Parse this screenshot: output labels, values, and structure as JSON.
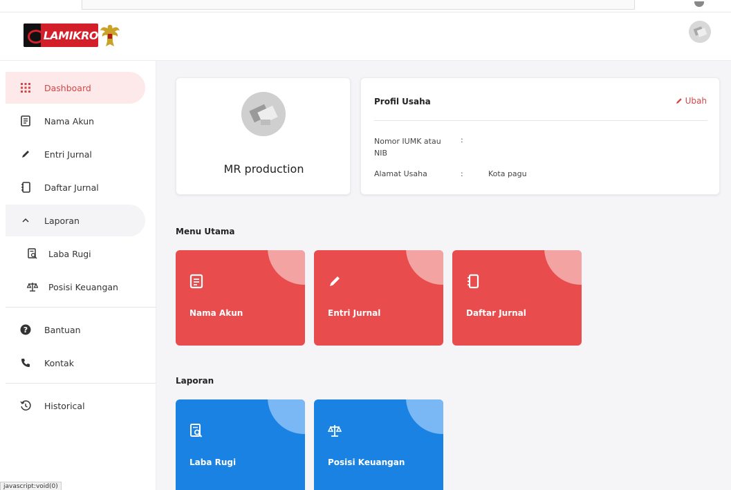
{
  "brand": {
    "logo_text": "LAMIKRO"
  },
  "sidebar": {
    "items": [
      {
        "label": "Dashboard"
      },
      {
        "label": "Nama Akun"
      },
      {
        "label": "Entri Jurnal"
      },
      {
        "label": "Daftar Jurnal"
      },
      {
        "label": "Laporan"
      },
      {
        "label": "Laba Rugi"
      },
      {
        "label": "Posisi Keuangan"
      },
      {
        "label": "Bantuan"
      },
      {
        "label": "Kontak"
      },
      {
        "label": "Historical"
      }
    ]
  },
  "status_bar": {
    "text": "javascript:void(0)"
  },
  "profile": {
    "name": "MR production"
  },
  "business_profile": {
    "title": "Profil Usaha",
    "edit_label": "Ubah",
    "iumk_label_line1": "Nomor IUMK atau",
    "iumk_label_line2": "NIB",
    "iumk_colon": ":",
    "iumk_value": "",
    "address_label": "Alamat Usaha",
    "address_colon": ":",
    "address_value": "Kota pagu"
  },
  "main_menu": {
    "title": "Menu Utama",
    "tiles": [
      {
        "label": "Nama Akun",
        "icon": "document-icon"
      },
      {
        "label": "Entri Jurnal",
        "icon": "pencil-icon"
      },
      {
        "label": "Daftar Jurnal",
        "icon": "notebook-icon"
      }
    ]
  },
  "reports": {
    "title": "Laporan",
    "tiles": [
      {
        "label": "Laba Rugi",
        "icon": "report-search-icon"
      },
      {
        "label": "Posisi Keuangan",
        "icon": "balance-scale-icon"
      }
    ]
  },
  "colors": {
    "accent_red": "#e84c4c",
    "accent_blue": "#1a82e2",
    "active_bg": "#fde9e9"
  }
}
